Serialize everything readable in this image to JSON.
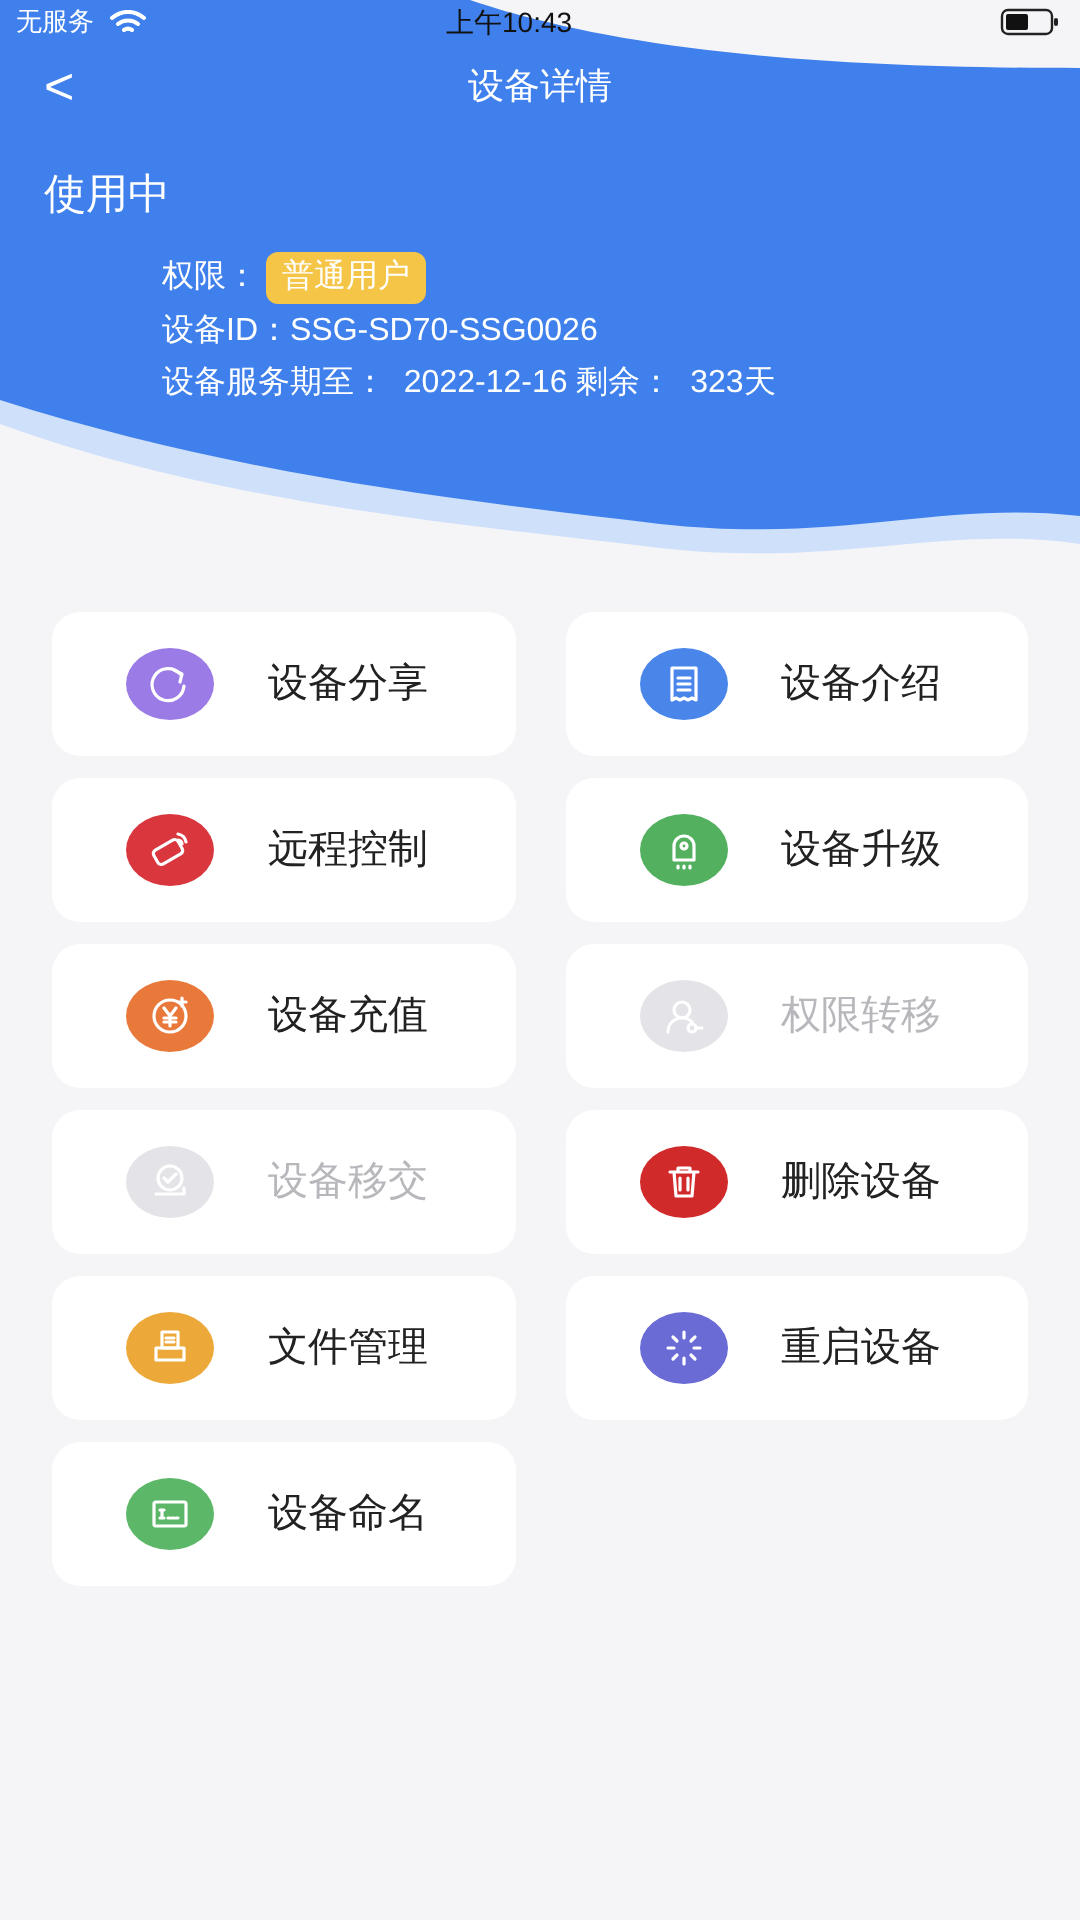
{
  "status_bar": {
    "carrier": "无服务",
    "time": "上午10:43"
  },
  "nav": {
    "back": "<",
    "title": "设备详情"
  },
  "device": {
    "status": "使用中",
    "permission_label": "权限：",
    "permission": "普通用户",
    "id_line": "设备ID：SSG-SD70-SSG0026",
    "service_line": "设备服务期至：  2022-12-16 剩余：  323天"
  },
  "actions": [
    {
      "label": "设备分享",
      "kind": "share",
      "color": "#9b7be6",
      "disabled": false
    },
    {
      "label": "设备介绍",
      "kind": "intro",
      "color": "#4a86ea",
      "disabled": false
    },
    {
      "label": "远程控制",
      "kind": "remote",
      "color": "#d9363e",
      "disabled": false
    },
    {
      "label": "设备升级",
      "kind": "upgrade",
      "color": "#52b05e",
      "disabled": false
    },
    {
      "label": "设备充值",
      "kind": "recharge",
      "color": "#e9793a",
      "disabled": false
    },
    {
      "label": "权限转移",
      "kind": "transfer",
      "color": "#e3e3e8",
      "disabled": true
    },
    {
      "label": "设备移交",
      "kind": "handover",
      "color": "#e3e3e8",
      "disabled": true
    },
    {
      "label": "删除设备",
      "kind": "delete",
      "color": "#d12a2a",
      "disabled": false
    },
    {
      "label": "文件管理",
      "kind": "files",
      "color": "#eda83a",
      "disabled": false
    },
    {
      "label": "重启设备",
      "kind": "restart",
      "color": "#6b6bd6",
      "disabled": false
    },
    {
      "label": "设备命名",
      "kind": "rename",
      "color": "#5cb868",
      "disabled": false
    }
  ]
}
